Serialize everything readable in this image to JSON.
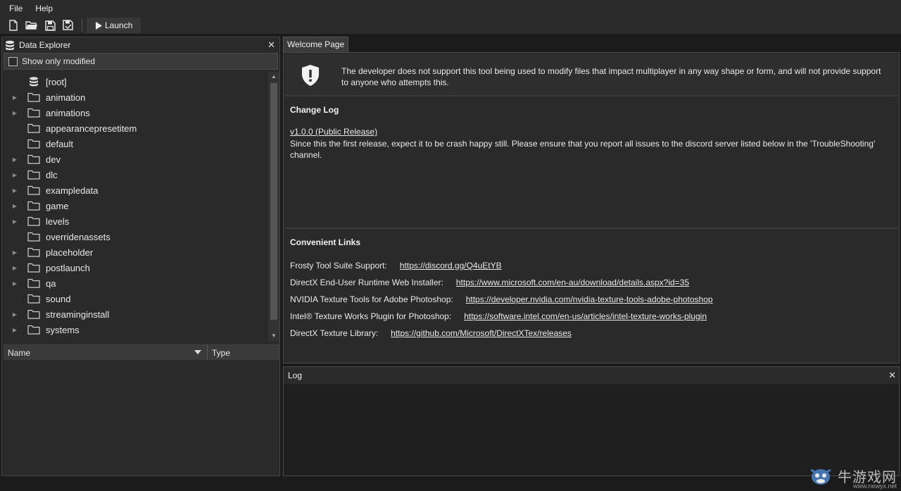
{
  "menu": {
    "file": "File",
    "help": "Help"
  },
  "toolbar": {
    "launch_label": "Launch"
  },
  "explorer": {
    "title": "Data Explorer",
    "filter_label": "Show only modified",
    "root_label": "[root]",
    "items": [
      {
        "label": "animation",
        "expandable": true
      },
      {
        "label": "animations",
        "expandable": true
      },
      {
        "label": "appearancepresetitem",
        "expandable": false
      },
      {
        "label": "default",
        "expandable": false
      },
      {
        "label": "dev",
        "expandable": true
      },
      {
        "label": "dlc",
        "expandable": true
      },
      {
        "label": "exampledata",
        "expandable": true
      },
      {
        "label": "game",
        "expandable": true
      },
      {
        "label": "levels",
        "expandable": true
      },
      {
        "label": "overridenassets",
        "expandable": false
      },
      {
        "label": "placeholder",
        "expandable": true
      },
      {
        "label": "postlaunch",
        "expandable": true
      },
      {
        "label": "qa",
        "expandable": true
      },
      {
        "label": "sound",
        "expandable": false
      },
      {
        "label": "streaminginstall",
        "expandable": true
      },
      {
        "label": "systems",
        "expandable": true
      }
    ],
    "columns": {
      "name": "Name",
      "type": "Type"
    }
  },
  "tabs": {
    "welcome": "Welcome Page"
  },
  "welcome": {
    "notice": "The developer does not support this tool being used to modify files that impact multiplayer in any way shape or form, and will not provide support to anyone who attempts this.",
    "changelog_title": "Change Log",
    "version": "v1.0.0 (Public Release)",
    "changelog_text": "Since this the first release, expect it to be crash happy still. Please ensure that you report all issues to the discord server listed below in the 'TroubleShooting' channel.",
    "links_title": "Convenient Links",
    "links": [
      {
        "label": "Frosty Tool Suite Support:",
        "url": "https://discord.gg/Q4uEtYB"
      },
      {
        "label": "DirectX End-User Runtime Web Installer:",
        "url": "https://www.microsoft.com/en-au/download/details.aspx?id=35"
      },
      {
        "label": "NVIDIA Texture Tools for Adobe Photoshop:",
        "url": "https://developer.nvidia.com/nvidia-texture-tools-adobe-photoshop"
      },
      {
        "label": "Intel® Texture Works Plugin for Photoshop:",
        "url": "https://software.intel.com/en-us/articles/intel-texture-works-plugin"
      },
      {
        "label": "DirectX Texture Library:",
        "url": "https://github.com/Microsoft/DirectXTex/releases"
      }
    ]
  },
  "log": {
    "title": "Log"
  },
  "watermark": {
    "text": "牛游戏网",
    "url": "www.newyx.net"
  },
  "colors": {
    "background": "#1b1b1b",
    "panel": "#2a2a2a",
    "text": "#e6e6e6"
  }
}
